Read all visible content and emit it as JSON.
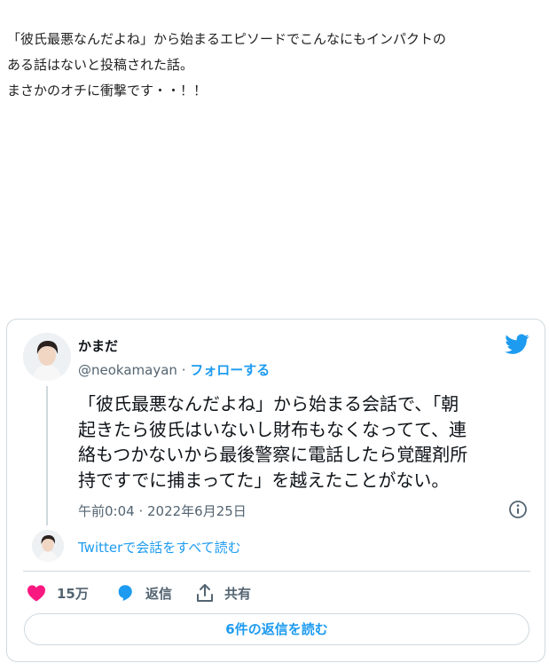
{
  "article": {
    "lines": [
      "「彼氏最悪なんだよね」から始まるエピソードでこんなにもインパクトの",
      "ある話はないと投稿された話。",
      "まさかのオチに衝撃です・・！！"
    ]
  },
  "tweet": {
    "author_name": "かまだ",
    "handle": "@neokamayan",
    "separator": " · ",
    "follow_label": "フォローする",
    "body_lines": [
      "「彼氏最悪なんだよね」から始まる会話で、「朝",
      "起きたら彼氏はいないし財布もなくなってて、連",
      "絡もつかないから最後警察に電話したら覚醒剤所",
      "持ですでに捕まってた」を越えたことがない。"
    ],
    "timestamp": "午前0:04 · 2022年6月25日",
    "read_thread_label": "Twitterで会話をすべて読む",
    "actions": {
      "like_count": "15万",
      "reply_label": "返信",
      "share_label": "共有"
    },
    "replies_button_label": "6件の返信を読む"
  },
  "icons": {
    "brand": "twitter-bird-icon",
    "like": "heart-icon",
    "reply": "speech-bubble-icon",
    "share": "share-upload-icon",
    "info": "info-icon"
  },
  "colors": {
    "twitter_blue": "#1d9bf0",
    "like_pink": "#f91880",
    "text_primary": "#0f1419",
    "text_secondary": "#536471",
    "border": "#cfd9de"
  }
}
